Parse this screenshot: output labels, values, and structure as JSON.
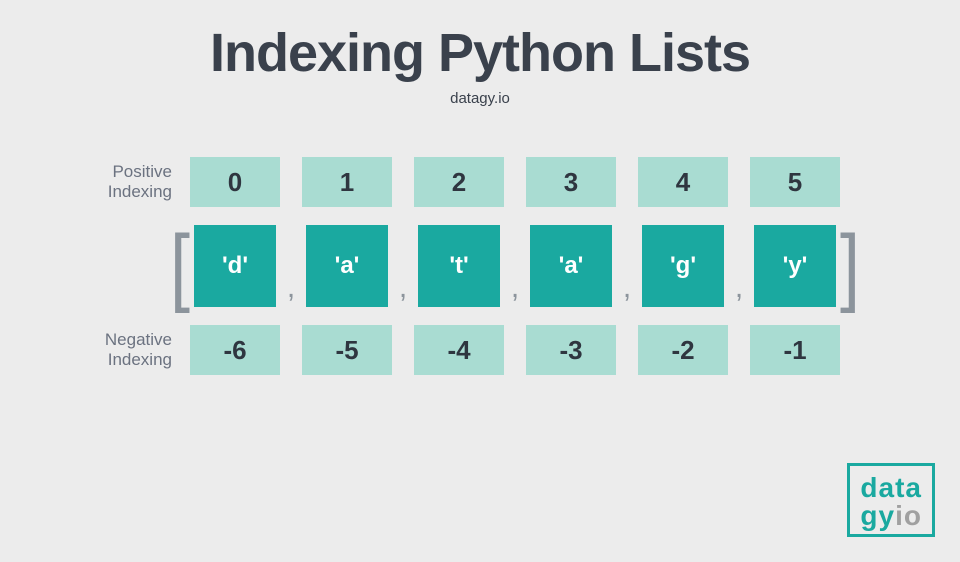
{
  "title": "Indexing Python Lists",
  "subtitle": "datagy.io",
  "positive_label": "Positive\nIndexing",
  "negative_label": "Negative\nIndexing",
  "positive_indices": [
    "0",
    "1",
    "2",
    "3",
    "4",
    "5"
  ],
  "list_items": [
    "'d'",
    "'a'",
    "'t'",
    "'a'",
    "'g'",
    "'y'"
  ],
  "negative_indices": [
    "-6",
    "-5",
    "-4",
    "-3",
    "-2",
    "-1"
  ],
  "comma": ",",
  "bracket_left": "[",
  "bracket_right": "]",
  "logo": {
    "line1": "data",
    "line2a": "gy",
    "line2b": "io"
  },
  "colors": {
    "accent": "#1aa9a0",
    "light": "#a9dcd2",
    "text": "#3a414c",
    "muted": "#8c949c"
  }
}
